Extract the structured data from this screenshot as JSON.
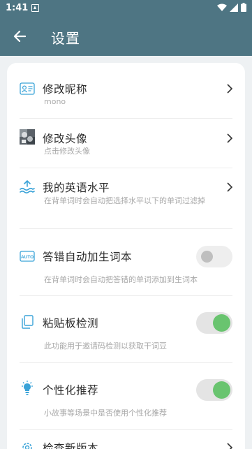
{
  "status_bar": {
    "time": "1:41"
  },
  "app_bar": {
    "title": "设置"
  },
  "settings": [
    {
      "label": "修改昵称",
      "sub": "mono",
      "icon": "id-card-icon"
    },
    {
      "label": "修改头像",
      "sub": "点击修改头像",
      "icon": "avatar-thumbnail"
    },
    {
      "label": "我的英语水平",
      "sub": "在背单词时会自动把选择水平以下的单词过滤掉",
      "icon": "water-level-icon"
    },
    {
      "label": "答错自动加生词本",
      "sub": "在背单词时会自动把答错的单词添加到生词本",
      "icon": "auto-icon",
      "toggle_on": false
    },
    {
      "label": "粘贴板检测",
      "sub": "此功能用于邀请码检测以获取干词豆",
      "icon": "clipboard-icon",
      "toggle_on": true
    },
    {
      "label": "个性化推荐",
      "sub": "小故事等场景中是否使用个性化推荐",
      "icon": "lightbulb-icon",
      "toggle_on": true
    },
    {
      "label": "检查新版本",
      "icon": "gear-icon"
    }
  ],
  "colors": {
    "accent": "#4e7583",
    "icon_blue": "#3aa3d8",
    "toggle_on": "#69c46f"
  }
}
